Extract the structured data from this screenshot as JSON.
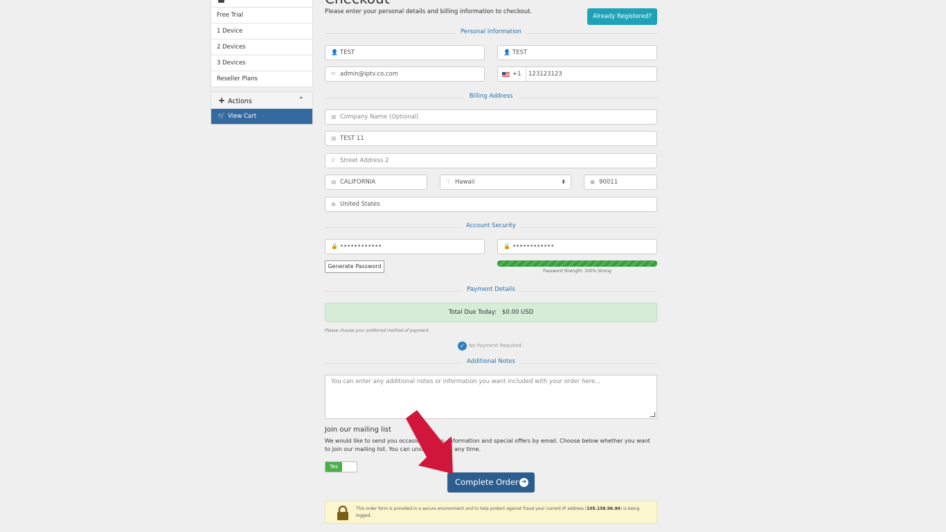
{
  "sidebar": {
    "items": [
      "Free Trial",
      "1 Device",
      "2 Devices",
      "3 Devices",
      "Reseller Plans"
    ],
    "actions_label": "Actions",
    "view_cart_label": "View Cart"
  },
  "header": {
    "title": "Checkout",
    "subtitle": "Please enter your personal details and billing information to checkout.",
    "already_registered": "Already Registered?"
  },
  "sections": {
    "personal": "Personal Information",
    "billing": "Billing Address",
    "security": "Account Security",
    "payment": "Payment Details",
    "notes": "Additional Notes"
  },
  "personal": {
    "first_name": "TEST",
    "last_name": "TEST",
    "email": "admin@iptv.co.com",
    "phone_code": "+1",
    "phone": "123123123"
  },
  "billing": {
    "company_placeholder": "Company Name (Optional)",
    "address1": "TEST 11",
    "address2_placeholder": "Street Address 2",
    "city": "CALIFORNIA",
    "state": "Hawaii",
    "postcode": "90011",
    "country": "United States"
  },
  "security": {
    "password_mask": "••••••••••••",
    "confirm_mask": "••••••••••••",
    "generate_label": "Generate Password",
    "strength_text": "Password Strength: 100% Strong",
    "strength_fraction": 1.0
  },
  "payment": {
    "total_label": "Total Due Today:",
    "total_value": "$0.00 USD",
    "choose_text": "Please choose your preferred method of payment.",
    "no_payment": "No Payment Required"
  },
  "notes": {
    "placeholder": "You can enter any additional notes or information you want included with your order here..."
  },
  "mailing": {
    "title": "Join our mailing list",
    "text": "We would like to send you occasional news, information and special offers by email. Choose below whether you want to join our mailing list. You can unsubscribe at any time.",
    "toggle_label": "Yes"
  },
  "complete_label": "Complete Order",
  "secure_notice": {
    "text_before": "This order form is provided in a secure environment and to help protect against fraud your current IP address (",
    "ip": "105.158.96.90",
    "text_after": ") is being logged."
  },
  "colors": {
    "primary": "#2c5d8f",
    "info": "#1fa2b8",
    "success": "#4aae4a",
    "arrow": "#d0173b"
  }
}
